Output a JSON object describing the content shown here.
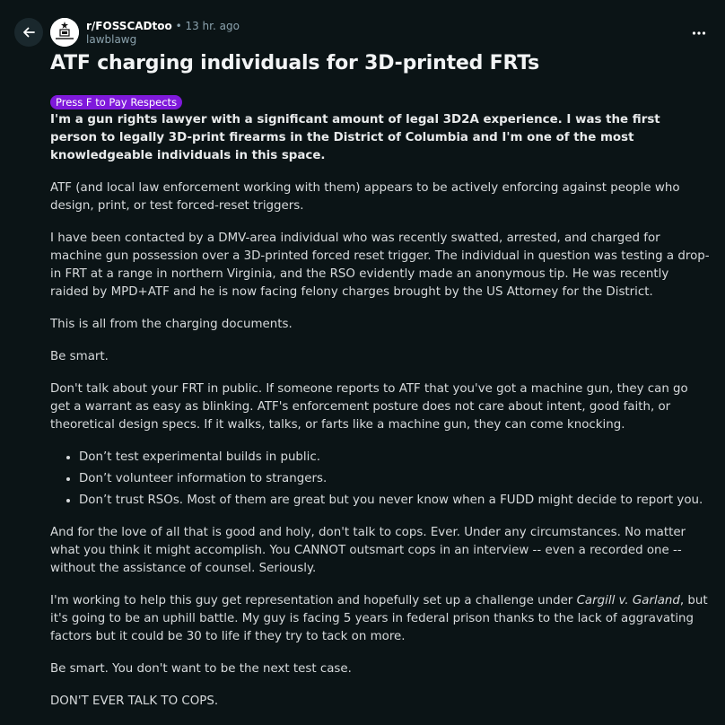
{
  "header": {
    "subreddit": "r/FOSSCADtoo",
    "separator": "•",
    "time": "13 hr. ago",
    "author": "lawblawg"
  },
  "post": {
    "title": "ATF charging individuals for 3D-printed FRTs",
    "flair": "Press F to Pay Respects",
    "lead": "I'm a gun rights lawyer with a significant amount of legal 3D2A experience. I was the first person to legally 3D-print firearms in the District of Columbia and I'm one of the most knowledgeable individuals in this space.",
    "p1": "ATF (and local law enforcement working with them) appears to be actively enforcing against people who design, print, or test forced-reset triggers.",
    "p2": "I have been contacted by a DMV-area individual who was recently swatted, arrested, and charged for machine gun possession over a 3D-printed forced reset trigger. The individual in question was testing a drop-in FRT at a range in northern Virginia, and the RSO evidently made an anonymous tip. He was recently raided by MPD+ATF and he is now facing felony charges brought by the US Attorney for the District.",
    "p3": "This is all from the charging documents.",
    "p4": "Be smart.",
    "p5": "Don't talk about your FRT in public. If someone reports to ATF that you've got a machine gun, they can go get a warrant as easy as blinking. ATF's enforcement posture does not care about intent, good faith, or theoretical design specs. If it walks, talks, or farts like a machine gun, they can come knocking.",
    "bullets": [
      "Don’t test experimental builds in public.",
      "Don’t volunteer information to strangers.",
      "Don’t trust RSOs. Most of them are great but you never know when a FUDD might decide to report you."
    ],
    "p6": "And for the love of all that is good and holy, don't talk to cops. Ever. Under any circumstances. No matter what you think it might accomplish. You CANNOT outsmart cops in an interview -- even a recorded one -- without the assistance of counsel. Seriously.",
    "p7_before": "I'm working to help this guy get representation and hopefully set up a challenge under ",
    "p7_case": "Cargill v. Garland",
    "p7_after": ", but it's going to be an uphill battle. My guy is facing 5 years in federal prison thanks to the lack of aggravating factors but it could be 30 to life if they try to tack on more.",
    "p8": "Be smart. You don't want to be the next test case.",
    "p9": "DON'T EVER TALK TO COPS."
  }
}
